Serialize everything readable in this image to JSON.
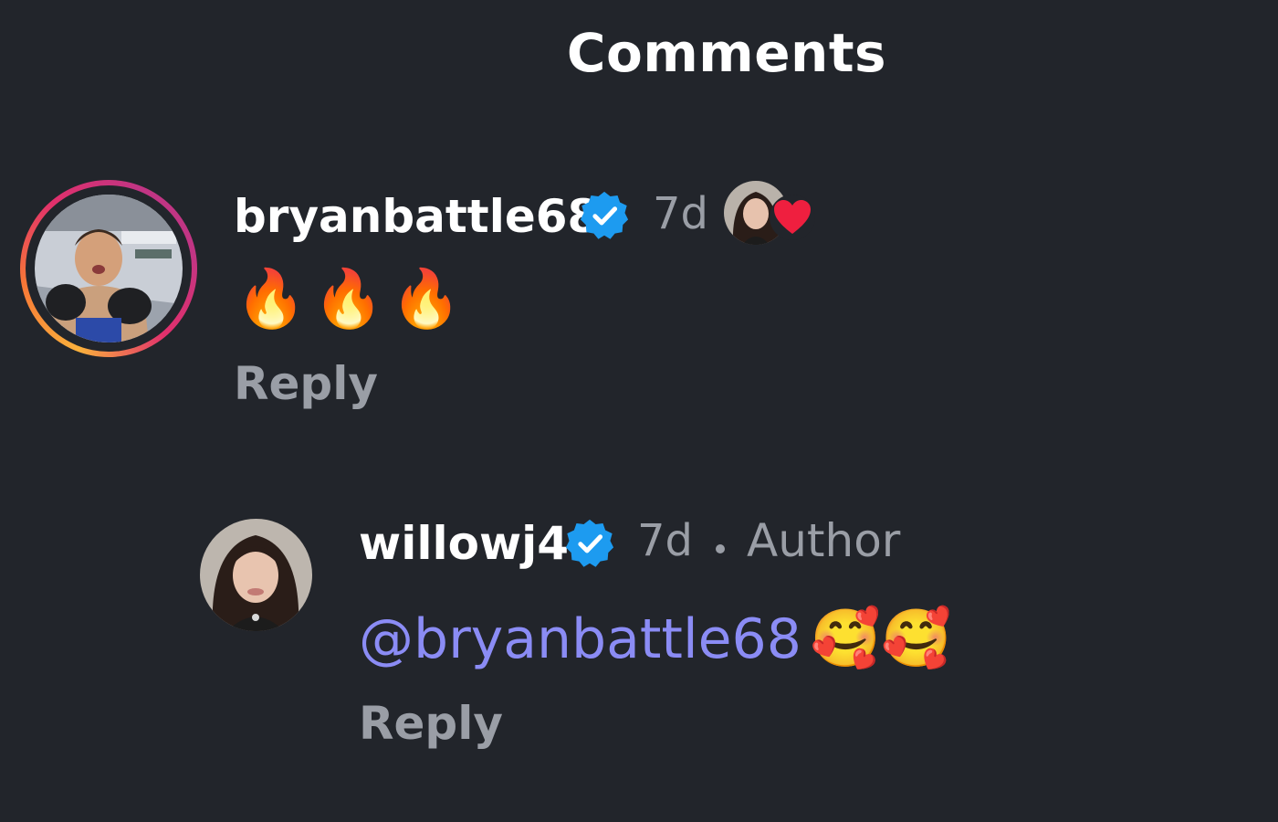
{
  "header": {
    "title": "Comments"
  },
  "colors": {
    "background": "#22252b",
    "text_primary": "#ffffff",
    "text_secondary": "#9a9ea6",
    "mention": "#8b8cf5",
    "verified_blue": "#1d9bf0",
    "like_red": "#ef1f3f"
  },
  "comments": [
    {
      "username": "bryanbattle68",
      "verified": true,
      "verified_icon": "verified-badge-icon",
      "time": "7d",
      "liked_by_author": true,
      "liked_icon": "heart-icon",
      "text": "🔥🔥🔥",
      "reply_label": "Reply",
      "replies": [
        {
          "username": "willowj4",
          "verified": true,
          "verified_icon": "verified-badge-icon",
          "time": "7d",
          "author_label": "Author",
          "mention": "@bryanbattle68",
          "mention_icon": "threads-at-icon",
          "text": "🥰🥰",
          "reply_label": "Reply"
        }
      ]
    }
  ]
}
